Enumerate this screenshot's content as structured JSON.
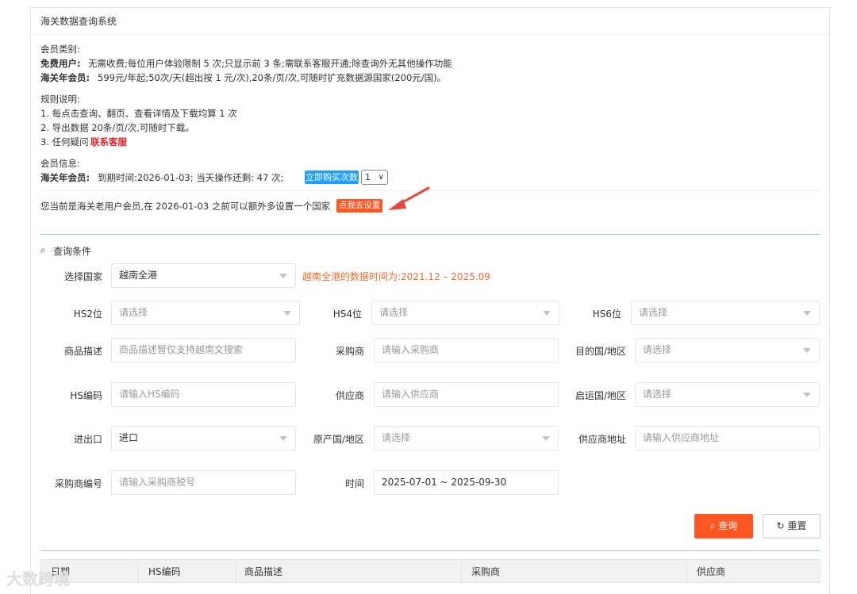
{
  "panel": {
    "title": "海关数据查询系统"
  },
  "membership": {
    "heading": "会员类别:",
    "free_label": "免费用户:",
    "free_desc": "无需收费;每位用户体验限制 5 次;只显示前 3 条;需联系客服开通;除查询外无其他操作功能",
    "annual_label": "海关年会员:",
    "annual_desc": "599元/年起;50次/天(超出按 1 元/次),20条/页/次,可随时扩充数据源国家(200元/国)。"
  },
  "rules": {
    "heading": "规则说明:",
    "item1": "1. 每点击查询、翻页、查看详情及下载均算 1 次",
    "item2": "2. 导出数据 20条/页/次,可随时下载。",
    "item3_prefix": "3. 任何疑问",
    "item3_link": "联系客服"
  },
  "member_info": {
    "heading": "会员信息:",
    "type_label": "海关年会员:",
    "detail": "到期时间:2026-01-03; 当天操作还剩: 47 次;",
    "buy_button": "立即购买次数",
    "count_value": "1"
  },
  "notice": {
    "text": "您当前是海关老用户会员,在 2026-01-03 之前可以额外多设置一个国家",
    "button": "点我去设置"
  },
  "query": {
    "section_title": "查询条件",
    "country_label": "选择国家",
    "country_value": "越南全港",
    "data_range_note": "越南全港的数据时间为:2021.12 – 2025.09",
    "hs2_label": "HS2位",
    "hs2_placeholder": "请选择",
    "hs4_label": "HS4位",
    "hs4_placeholder": "请选择",
    "hs6_label": "HS6位",
    "hs6_placeholder": "请选择",
    "desc_label": "商品描述",
    "desc_placeholder": "商品描述暂仅支持越南文搜索",
    "buyer_label": "采购商",
    "buyer_placeholder": "请输入采购商",
    "dest_label": "目的国/地区",
    "dest_placeholder": "请选择",
    "hscode_label": "HS编码",
    "hscode_placeholder": "请输入HS编码",
    "supplier_label": "供应商",
    "supplier_placeholder": "请输入供应商",
    "origin_port_label": "启运国/地区",
    "origin_port_placeholder": "请选择",
    "io_label": "进出口",
    "io_value": "进口",
    "origin_country_label": "原产国/地区",
    "origin_country_placeholder": "请选择",
    "supplier_addr_label": "供应商地址",
    "supplier_addr_placeholder": "请输入供应商地址",
    "buyer_code_label": "采购商编号",
    "buyer_code_placeholder": "请输入采购商税号",
    "time_label": "时间",
    "time_value": "2025-07-01 ~ 2025-09-30",
    "search_button": "查询",
    "reset_button": "重置"
  },
  "table": {
    "columns": [
      "日期",
      "HS编码",
      "商品描述",
      "采购商",
      "供应商"
    ]
  },
  "watermark": "大数跨境",
  "colors": {
    "primary_red": "#ff5722",
    "primary_blue": "#1e9fff",
    "accent_teal": "#8fd3d3",
    "arrow_red": "#e8453c"
  }
}
